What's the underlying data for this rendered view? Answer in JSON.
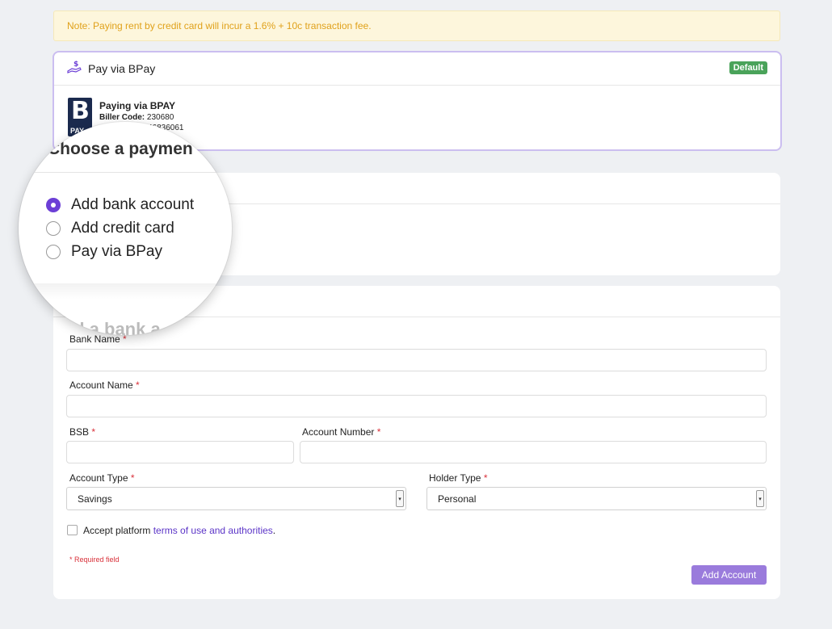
{
  "notice": {
    "text": "Note: Paying rent by credit card will incur a 1.6% + 10c transaction fee."
  },
  "bpay_card": {
    "title": "Pay via BPay",
    "icon": "hand-money-icon",
    "badge": "Default",
    "logo_text": "PAY",
    "info_title": "Paying via BPAY",
    "biller_label": "Biller Code:",
    "biller_value": "230680",
    "ref_value": "46836061"
  },
  "magnifier": {
    "heading": "Choose a paymen",
    "options": [
      {
        "label": "Add bank account",
        "selected": true
      },
      {
        "label": "Add credit card",
        "selected": false
      },
      {
        "label": "Pay via BPay",
        "selected": false
      }
    ],
    "footer_text": "ld a bank a"
  },
  "form": {
    "bank_name_label": "Bank Name",
    "account_name_label": "Account Name",
    "bsb_label": "BSB",
    "account_number_label": "Account Number",
    "account_type_label": "Account Type",
    "account_type_value": "Savings",
    "holder_type_label": "Holder Type",
    "holder_type_value": "Personal",
    "required_marker": "*",
    "accept_prefix": "Accept platform",
    "accept_link": "terms of use and authorities",
    "accept_suffix": ".",
    "required_note": "* Required field",
    "submit_label": "Add Account"
  },
  "colors": {
    "accent": "#6c3fd6",
    "button": "#9a7bdc",
    "badge": "#4aa35a",
    "notice_text": "#e0a11a",
    "required": "#d9313a"
  }
}
